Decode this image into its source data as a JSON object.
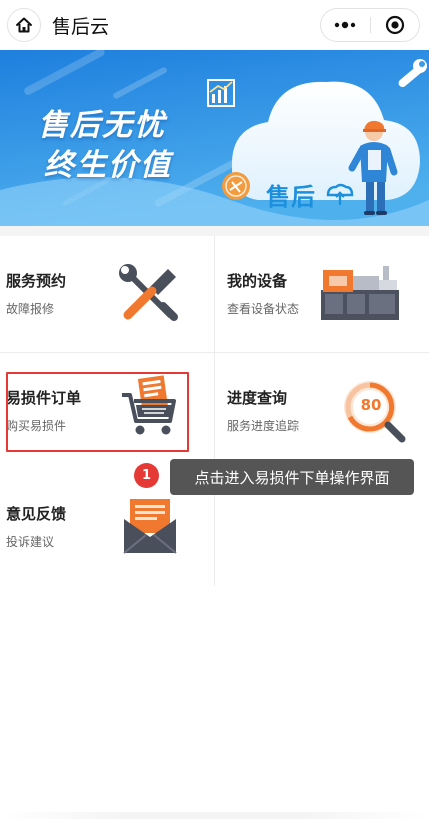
{
  "header": {
    "title": "售后云",
    "icons": {
      "home": "home-icon",
      "more": "more-dots-icon",
      "close": "record-close-icon"
    }
  },
  "banner": {
    "line1": "售后无忧",
    "line2": "终生价值",
    "cloud_text": "售后",
    "colors": {
      "sky_top": "#1d84e0",
      "sky_bottom": "#7fc8f5",
      "accent_orange": "#f28a3b"
    }
  },
  "grid": {
    "items": [
      {
        "title": "服务预约",
        "subtitle": "故障报修",
        "icon": "tools-wrench-screwdriver-icon"
      },
      {
        "title": "我的设备",
        "subtitle": "查看设备状态",
        "icon": "machine-equipment-icon"
      },
      {
        "title": "易损件订单",
        "subtitle": "购买易损件",
        "icon": "shopping-cart-icon"
      },
      {
        "title": "进度查询",
        "subtitle": "服务进度追踪",
        "icon": "progress-magnifier-icon",
        "progress_value": "80"
      },
      {
        "title": "意见反馈",
        "subtitle": "投诉建议",
        "icon": "envelope-letter-icon"
      }
    ]
  },
  "annotation": {
    "step": "1",
    "tooltip": "点击进入易损件下单操作界面",
    "highlight_color": "#e53935"
  }
}
